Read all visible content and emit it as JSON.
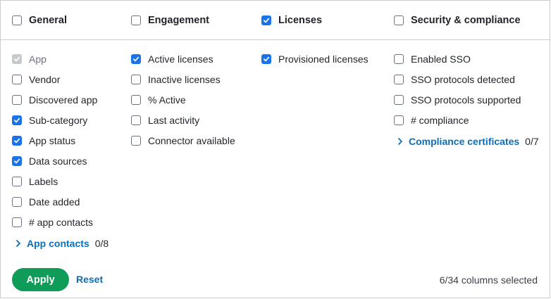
{
  "columns": [
    {
      "label": "General",
      "checked": false
    },
    {
      "label": "Engagement",
      "checked": false
    },
    {
      "label": "Licenses",
      "checked": true
    },
    {
      "label": "Security & compliance",
      "checked": false
    }
  ],
  "general": {
    "items": [
      {
        "label": "App",
        "checked": true,
        "disabled": true
      },
      {
        "label": "Vendor",
        "checked": false
      },
      {
        "label": "Discovered app",
        "checked": false
      },
      {
        "label": "Sub-category",
        "checked": true
      },
      {
        "label": "App status",
        "checked": true
      },
      {
        "label": "Data sources",
        "checked": true
      },
      {
        "label": "Labels",
        "checked": false
      },
      {
        "label": "Date added",
        "checked": false
      },
      {
        "label": "# app contacts",
        "checked": false
      }
    ],
    "expander": {
      "label": "App contacts",
      "count": "0/8"
    }
  },
  "engagement": {
    "items": [
      {
        "label": "Active licenses",
        "checked": true
      },
      {
        "label": "Inactive licenses",
        "checked": false
      },
      {
        "label": "% Active",
        "checked": false
      },
      {
        "label": "Last activity",
        "checked": false
      },
      {
        "label": "Connector available",
        "checked": false
      }
    ]
  },
  "licenses": {
    "items": [
      {
        "label": "Provisioned licenses",
        "checked": true
      }
    ]
  },
  "security": {
    "items": [
      {
        "label": "Enabled SSO",
        "checked": false
      },
      {
        "label": "SSO protocols detected",
        "checked": false
      },
      {
        "label": "SSO protocols supported",
        "checked": false
      },
      {
        "label": "# compliance",
        "checked": false
      }
    ],
    "expander": {
      "label": "Compliance certificates",
      "count": "0/7"
    }
  },
  "footer": {
    "apply_label": "Apply",
    "reset_label": "Reset",
    "status": "6/34 columns selected"
  },
  "colors": {
    "accent_blue": "#1a73e8",
    "link_blue": "#0b6fb8",
    "apply_green": "#0e9c58"
  }
}
